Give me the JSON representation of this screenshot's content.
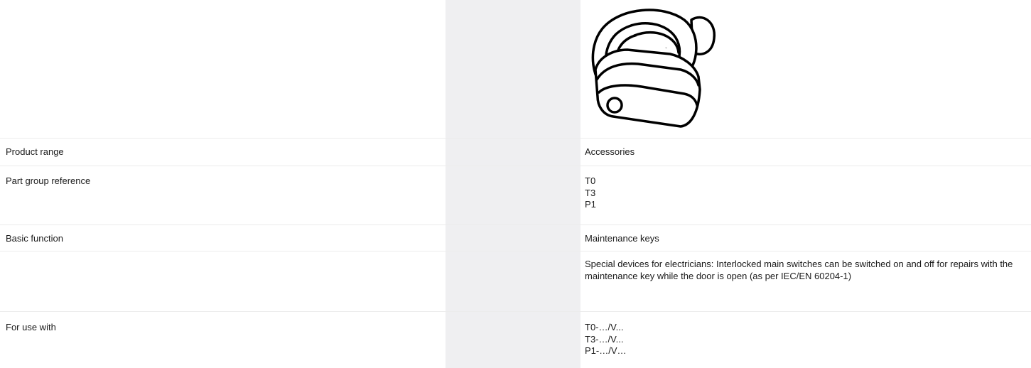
{
  "product_image": {
    "name": "maintenance-key-accessory-image"
  },
  "rows": [
    {
      "label": "Product range",
      "values": [
        "Accessories"
      ]
    },
    {
      "label": "Part group reference",
      "values": [
        "T0",
        "T3",
        "P1"
      ]
    },
    {
      "label": "Basic function",
      "values": [
        "Maintenance keys"
      ]
    },
    {
      "label": "",
      "values": [
        "Special devices for electricians: Interlocked main switches can be switched on and off for repairs with the maintenance key while the door is open (as per IEC/EN 60204-1)"
      ]
    },
    {
      "label": "For use with",
      "values": [
        "T0-…/V...",
        "T3-…/V...",
        "P1-…/V…"
      ]
    }
  ]
}
